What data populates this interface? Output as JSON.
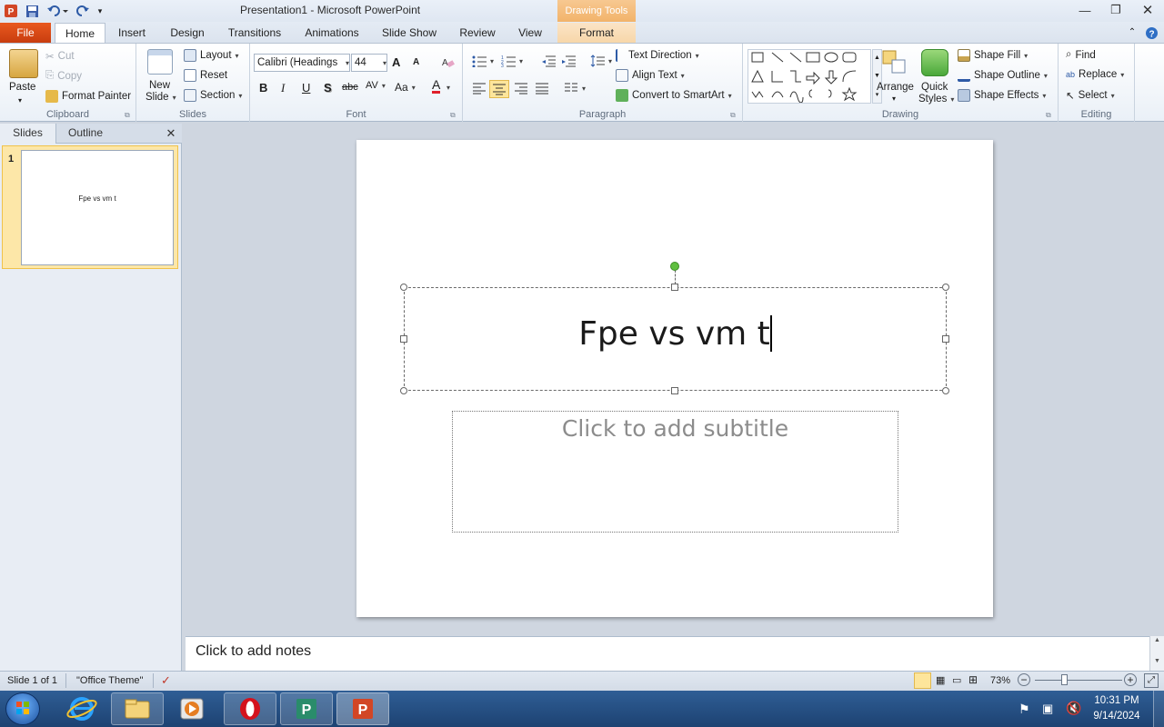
{
  "window": {
    "title": "Presentation1  -  Microsoft PowerPoint",
    "contextual_tab_group": "Drawing Tools"
  },
  "tabs": [
    "File",
    "Home",
    "Insert",
    "Design",
    "Transitions",
    "Animations",
    "Slide Show",
    "Review",
    "View",
    "Format"
  ],
  "ribbon": {
    "clipboard": {
      "label": "Clipboard",
      "paste": "Paste",
      "cut": "Cut",
      "copy": "Copy",
      "format_painter": "Format Painter"
    },
    "slides": {
      "label": "Slides",
      "new_slide_line1": "New",
      "new_slide_line2": "Slide",
      "layout": "Layout",
      "reset": "Reset",
      "section": "Section"
    },
    "font": {
      "label": "Font",
      "font_name": "Calibri (Headings",
      "font_size": "44",
      "bold": "B",
      "italic": "I",
      "underline": "U",
      "shadow": "S",
      "strike": "abc",
      "spacing": "AV",
      "case": "Aa",
      "grow": "A",
      "shrink": "A",
      "color": "A"
    },
    "paragraph": {
      "label": "Paragraph",
      "text_direction": "Text Direction",
      "align_text": "Align Text",
      "convert_smartart": "Convert to SmartArt"
    },
    "drawing": {
      "label": "Drawing",
      "arrange": "Arrange",
      "quick_styles_line1": "Quick",
      "quick_styles_line2": "Styles",
      "shape_fill": "Shape Fill",
      "shape_outline": "Shape Outline",
      "shape_effects": "Shape Effects"
    },
    "editing": {
      "label": "Editing",
      "find": "Find",
      "replace": "Replace",
      "select": "Select"
    }
  },
  "left_pane": {
    "tab_slides": "Slides",
    "tab_outline": "Outline",
    "thumbnail": {
      "number": "1",
      "title": "Fpe vs vm t"
    }
  },
  "slide": {
    "title_text": "Fpe vs vm t",
    "subtitle_placeholder": "Click to add subtitle"
  },
  "notes": {
    "placeholder": "Click to add notes"
  },
  "status": {
    "slide": "Slide 1 of 1",
    "theme": "\"Office Theme\"",
    "zoom": "73%"
  },
  "taskbar": {
    "time": "10:31 PM",
    "date": "9/14/2024"
  },
  "colors": {
    "file_tab": "#d9501a",
    "selection_green": "#5fbf3f",
    "taskbar": "#2a5586"
  }
}
